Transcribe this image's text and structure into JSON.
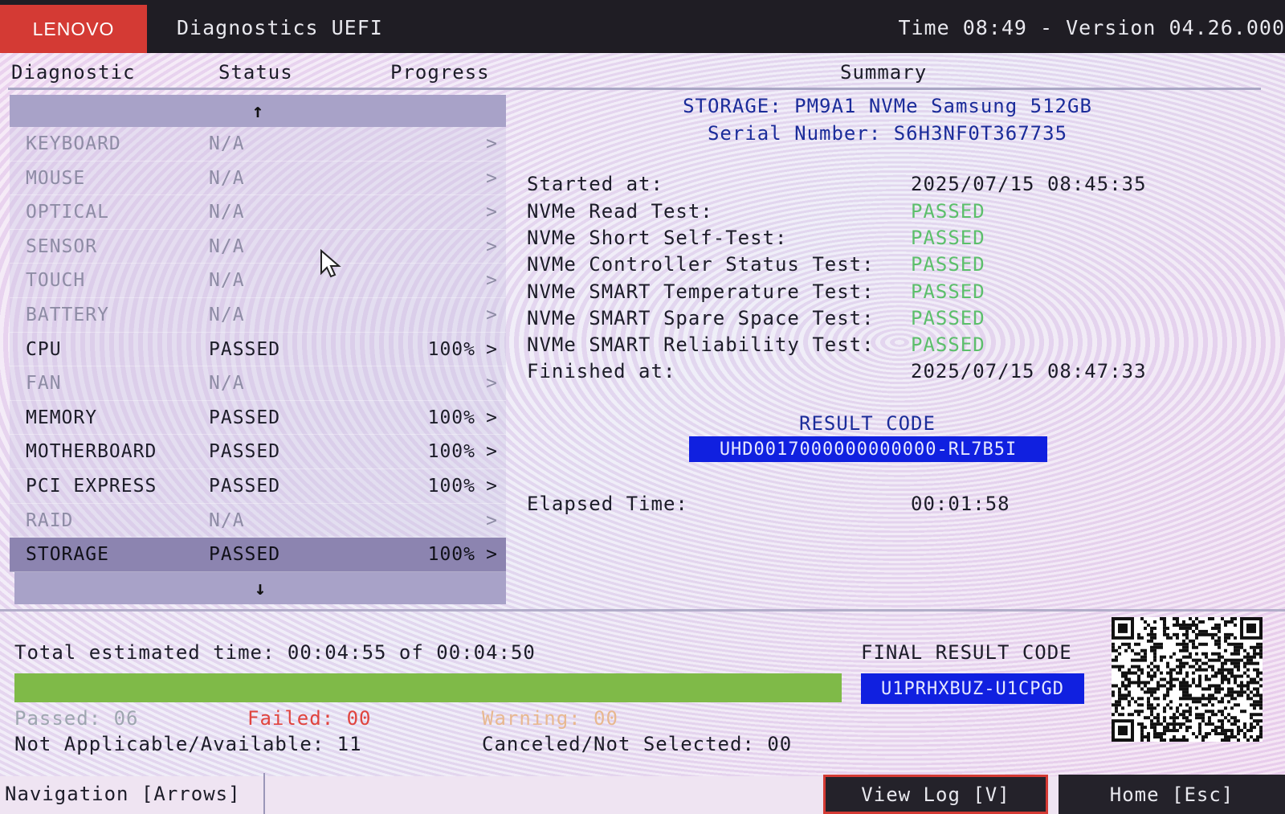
{
  "header": {
    "brand": "LENOVO",
    "title": "Diagnostics UEFI",
    "time_version": "Time 08:49 - Version 04.26.000"
  },
  "columns": {
    "diagnostic": "Diagnostic",
    "status": "Status",
    "progress": "Progress",
    "summary": "Summary"
  },
  "list": {
    "scroll_up": "↑",
    "scroll_down": "↓",
    "items": [
      {
        "name": "KEYBOARD",
        "status": "N/A",
        "progress": "",
        "chevron": ">"
      },
      {
        "name": "MOUSE",
        "status": "N/A",
        "progress": "",
        "chevron": ">"
      },
      {
        "name": "OPTICAL",
        "status": "N/A",
        "progress": "",
        "chevron": ">"
      },
      {
        "name": "SENSOR",
        "status": "N/A",
        "progress": "",
        "chevron": ">"
      },
      {
        "name": "TOUCH",
        "status": "N/A",
        "progress": "",
        "chevron": ">"
      },
      {
        "name": "BATTERY",
        "status": "N/A",
        "progress": "",
        "chevron": ">"
      },
      {
        "name": "CPU",
        "status": "PASSED",
        "progress": "100%",
        "chevron": ">"
      },
      {
        "name": "FAN",
        "status": "N/A",
        "progress": "",
        "chevron": ">"
      },
      {
        "name": "MEMORY",
        "status": "PASSED",
        "progress": "100%",
        "chevron": ">"
      },
      {
        "name": "MOTHERBOARD",
        "status": "PASSED",
        "progress": "100%",
        "chevron": ">"
      },
      {
        "name": "PCI EXPRESS",
        "status": "PASSED",
        "progress": "100%",
        "chevron": ">"
      },
      {
        "name": "RAID",
        "status": "N/A",
        "progress": "",
        "chevron": ">"
      },
      {
        "name": "STORAGE",
        "status": "PASSED",
        "progress": "100%",
        "chevron": ">"
      }
    ]
  },
  "summary": {
    "device": "STORAGE: PM9A1 NVMe Samsung 512GB",
    "serial": "Serial Number: S6H3NF0T367735",
    "started_label": "Started at:",
    "started_value": "2025/07/15 08:45:35",
    "tests": [
      {
        "label": "NVMe Read Test:",
        "result": "PASSED"
      },
      {
        "label": "NVMe Short Self-Test:",
        "result": "PASSED"
      },
      {
        "label": "NVMe Controller Status Test:",
        "result": "PASSED"
      },
      {
        "label": "NVMe SMART Temperature Test:",
        "result": "PASSED"
      },
      {
        "label": "NVMe SMART Spare Space Test:",
        "result": "PASSED"
      },
      {
        "label": "NVMe SMART Reliability Test:",
        "result": "PASSED"
      }
    ],
    "finished_label": "Finished at:",
    "finished_value": "2025/07/15 08:47:33",
    "result_code_label": "RESULT CODE",
    "result_code": "UHD0017000000000000-RL7B5I",
    "elapsed_label": "Elapsed Time:",
    "elapsed_value": "00:01:58"
  },
  "bottom": {
    "total_time": "Total estimated time: 00:04:55 of 00:04:50",
    "progress_fraction": 1.0,
    "passed": "Passed: 06",
    "failed": "Failed: 00",
    "warning": "Warning: 00",
    "not_applicable": "Not Applicable/Available: 11",
    "canceled": "Canceled/Not Selected: 00",
    "final_result_label": "FINAL RESULT CODE",
    "final_result_code": "U1PRHXBUZ-U1CPGD"
  },
  "footer": {
    "navigation": "Navigation [Arrows]",
    "view_log": "View Log [V]",
    "home": "Home [Esc]"
  },
  "colors": {
    "brand_red": "#d43a34",
    "passed_green": "#5cbf6b",
    "failed_red": "#e0443e",
    "code_blue": "#1020e0",
    "progress_green": "#7fba48"
  },
  "icons": [
    "arrow-up-icon",
    "arrow-down-icon",
    "chevron-right-icon",
    "mouse-cursor-icon",
    "qr-code"
  ]
}
